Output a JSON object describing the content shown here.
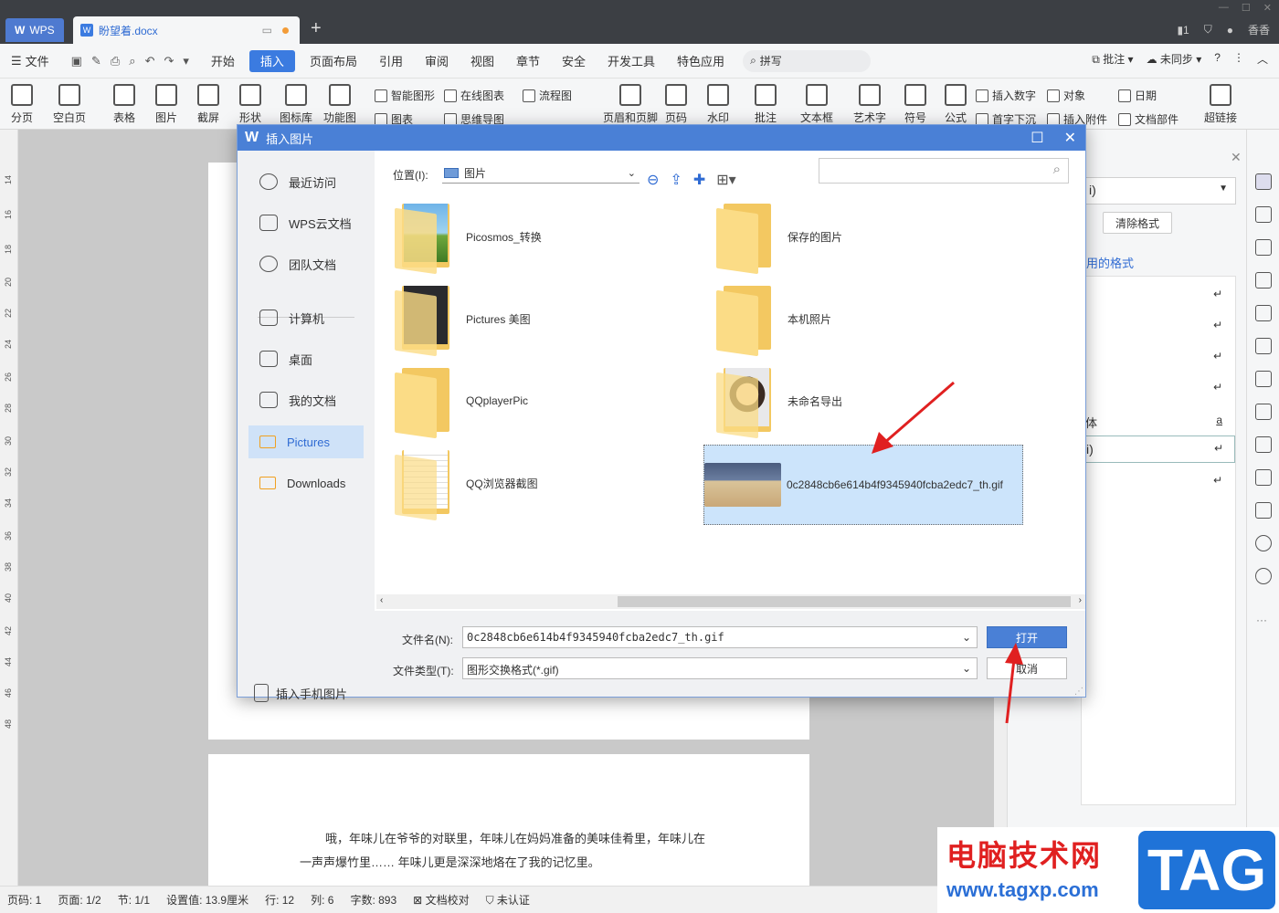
{
  "titlebar": {
    "app": "WPS",
    "doc_tab": "盼望着.docx",
    "user": "香香"
  },
  "menu": {
    "file": "文件",
    "tabs": [
      "开始",
      "插入",
      "页面布局",
      "引用",
      "审阅",
      "视图",
      "章节",
      "安全",
      "开发工具",
      "特色应用"
    ],
    "active_tab": "插入",
    "search": "拼写",
    "annotate": "批注",
    "sync": "未同步"
  },
  "ribbon": {
    "large": [
      "分页",
      "空白页",
      "表格",
      "图片",
      "截屏",
      "形状",
      "图标库",
      "功能图",
      "页眉和页脚",
      "页码",
      "水印",
      "批注",
      "文本框",
      "艺术字",
      "符号",
      "公式",
      "超链接"
    ],
    "small": [
      "智能图形",
      "在线图表",
      "流程图",
      "图表",
      "思维导图",
      "插入数字",
      "对象",
      "日期",
      "首字下沉",
      "插入附件",
      "文档部件"
    ]
  },
  "ruler": [
    "14",
    "16",
    "18",
    "20",
    "22",
    "24",
    "26",
    "28",
    "30",
    "32",
    "34",
    "36",
    "38",
    "40",
    "42",
    "44",
    "46",
    "48"
  ],
  "document": {
    "line1": "哦，年味儿在爷爷的对联里，年味儿在妈妈准备的美味佳肴里，年味儿在",
    "line2": "一声声爆竹里…… 年味儿更是深深地烙在了我的记忆里。"
  },
  "right_panel": {
    "select": "i)",
    "clear_button": "清除格式",
    "formats_label": "用的格式",
    "style_text": "体",
    "style_sel": "i)"
  },
  "status": [
    "页码: 1",
    "页面: 1/2",
    "节: 1/1",
    "设置值: 13.9厘米",
    "行: 12",
    "列: 6",
    "字数: 893",
    "文档校对",
    "未认证"
  ],
  "dialog": {
    "title": "插入图片",
    "sidebar": [
      {
        "label": "最近访问",
        "icon": "clock-icon"
      },
      {
        "label": "WPS云文档",
        "icon": "cube-icon"
      },
      {
        "label": "团队文档",
        "icon": "team-icon"
      },
      {
        "label": "计算机",
        "icon": "computer-icon"
      },
      {
        "label": "桌面",
        "icon": "desktop-icon"
      },
      {
        "label": "我的文档",
        "icon": "my-docs-icon"
      },
      {
        "label": "Pictures",
        "icon": "folder-icon"
      },
      {
        "label": "Downloads",
        "icon": "folder-icon"
      }
    ],
    "active_side": "Pictures",
    "location_label": "位置(I):",
    "location_value": "图片",
    "files": [
      {
        "name": "Picosmos_转换",
        "kind": "folder-photo"
      },
      {
        "name": "保存的图片",
        "kind": "folder"
      },
      {
        "name": "Pictures 美图",
        "kind": "folder-dark"
      },
      {
        "name": "本机照片",
        "kind": "folder"
      },
      {
        "name": "QQplayerPic",
        "kind": "folder"
      },
      {
        "name": "未命名导出",
        "kind": "folder-portrait"
      },
      {
        "name": "QQ浏览器截图",
        "kind": "folder-doc"
      },
      {
        "name": "0c2848cb6e614b4f9345940fcba2edc7_th.gif",
        "kind": "image"
      }
    ],
    "selected_file": "0c2848cb6e614b4f9345940fcba2edc7_th.gif",
    "filename_label": "文件名(N):",
    "filename_value": "0c2848cb6e614b4f9345940fcba2edc7_th.gif",
    "filetype_label": "文件类型(T):",
    "filetype_value": "图形交换格式(*.gif)",
    "open_button": "打开",
    "cancel_button": "取消",
    "phone_button": "插入手机图片"
  },
  "watermark": {
    "line1": "电脑技术网",
    "line2": "www.tagxp.com",
    "tag": "TAG"
  },
  "colors": {
    "accent": "#4a80d6",
    "selection": "#cce4fb",
    "annotation_arrow": "#e02020"
  }
}
